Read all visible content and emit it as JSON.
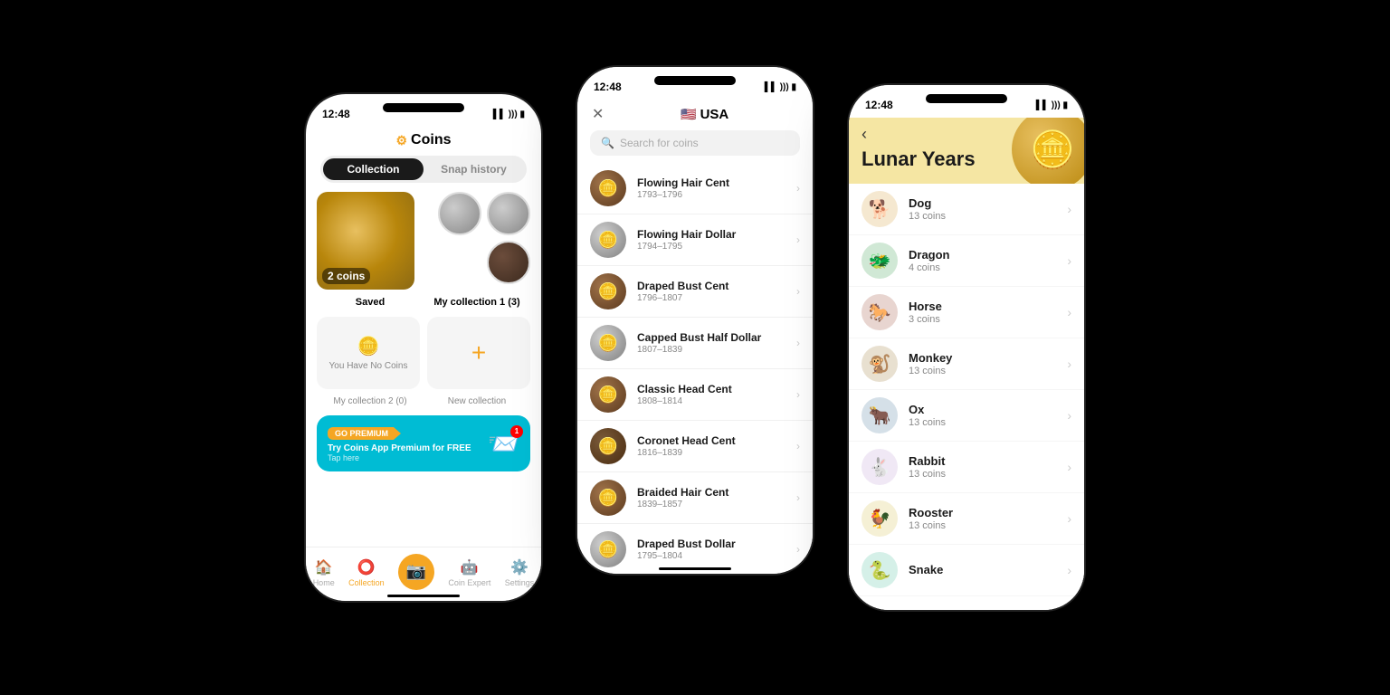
{
  "phone1": {
    "time": "12:48",
    "title": "Coins",
    "tabs": [
      "Collection",
      "Snap history"
    ],
    "saved": {
      "badge": "2 coins",
      "label": "Saved"
    },
    "myCollection1": {
      "label": "My collection 1 (3)"
    },
    "noCoins": {
      "label": "My collection 2 (0)",
      "text": "You Have No Coins"
    },
    "newCollection": {
      "label": "New collection"
    },
    "premium": {
      "tag": "GO PREMIUM",
      "text": "Try Coins App Premium for FREE",
      "cta": "Tap here"
    },
    "nav": {
      "home": "Home",
      "collection": "Collection",
      "coin_expert": "Coin Expert",
      "settings": "Settings"
    }
  },
  "phone2": {
    "time": "12:48",
    "country": "USA",
    "flag": "🇺🇸",
    "search_placeholder": "Search for coins",
    "coins": [
      {
        "name": "Flowing Hair Cent",
        "years": "1793–1796",
        "color": "brown"
      },
      {
        "name": "Flowing Hair Dollar",
        "years": "1794–1795",
        "color": "silver"
      },
      {
        "name": "Draped Bust Cent",
        "years": "1796–1807",
        "color": "brown"
      },
      {
        "name": "Capped Bust Half Dollar",
        "years": "1807–1839",
        "color": "silver"
      },
      {
        "name": "Classic Head Cent",
        "years": "1808–1814",
        "color": "brown"
      },
      {
        "name": "Coronet Head Cent",
        "years": "1816–1839",
        "color": "dark-brown"
      },
      {
        "name": "Braided Hair Cent",
        "years": "1839–1857",
        "color": "brown"
      },
      {
        "name": "Draped Bust Dollar",
        "years": "1795–1804",
        "color": "silver"
      }
    ]
  },
  "phone3": {
    "time": "12:48",
    "title": "Lunar Years",
    "animals": [
      {
        "name": "Dog",
        "coins": "13 coins",
        "emoji": "🐕",
        "bg": "av-dog"
      },
      {
        "name": "Dragon",
        "coins": "4 coins",
        "emoji": "🐲",
        "bg": "av-dragon"
      },
      {
        "name": "Horse",
        "coins": "3 coins",
        "emoji": "🐎",
        "bg": "av-horse"
      },
      {
        "name": "Monkey",
        "coins": "13 coins",
        "emoji": "🐒",
        "bg": "av-monkey"
      },
      {
        "name": "Ox",
        "coins": "13 coins",
        "emoji": "🐂",
        "bg": "av-ox"
      },
      {
        "name": "Rabbit",
        "coins": "13 coins",
        "emoji": "🐇",
        "bg": "av-rabbit"
      },
      {
        "name": "Rooster",
        "coins": "13 coins",
        "emoji": "🐓",
        "bg": "av-rooster"
      },
      {
        "name": "Snake",
        "coins": "",
        "emoji": "🐍",
        "bg": "av-snake"
      }
    ]
  }
}
